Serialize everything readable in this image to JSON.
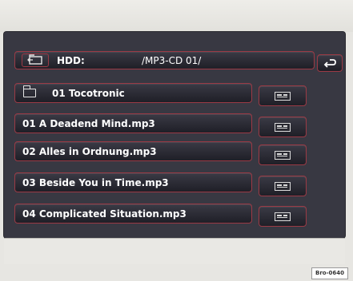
{
  "header": {
    "drive_label": "HDD:",
    "path": "/MP3-CD 01/"
  },
  "list": {
    "items": [
      {
        "label": "01 Tocotronic",
        "type": "folder"
      },
      {
        "label": "01 A Deadend Mind.mp3",
        "type": "file"
      },
      {
        "label": "02 Alles in Ordnung.mp3",
        "type": "file"
      },
      {
        "label": "03 Beside You in Time.mp3",
        "type": "file"
      },
      {
        "label": "04 Complicated Situation.mp3",
        "type": "file"
      }
    ]
  },
  "caption": "Bro-0640",
  "colors": {
    "screen_bg": "#383842",
    "button_border": "#9b3a45",
    "text": "#ffffff"
  },
  "icons": {
    "header_left": "folder-up-icon",
    "back": "back-arrow-icon",
    "folder": "folder-icon",
    "row_options": "options-icon"
  }
}
